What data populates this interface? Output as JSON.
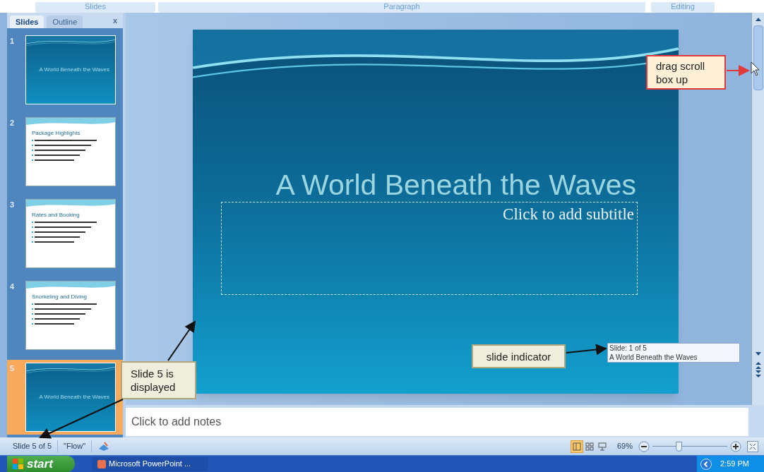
{
  "ribbon_groups": [
    "Slides",
    "Paragraph",
    "Editing"
  ],
  "pane": {
    "tabs": [
      {
        "label": "Slides",
        "selected": true
      },
      {
        "label": "Outline",
        "selected": false
      }
    ],
    "close": "x"
  },
  "thumbnails": [
    {
      "number": "1",
      "kind": "title",
      "title": "A World Beneath the Waves",
      "selected": false
    },
    {
      "number": "2",
      "kind": "bullets",
      "title": "Package Highlights",
      "selected": false
    },
    {
      "number": "3",
      "kind": "bullets",
      "title": "Rates and Booking",
      "selected": false
    },
    {
      "number": "4",
      "kind": "bullets",
      "title": "Snorkeling and Diving",
      "selected": false
    },
    {
      "number": "5",
      "kind": "title",
      "title": "A World Beneath the Waves",
      "selected": true
    }
  ],
  "slide": {
    "title": "A World Beneath the Waves",
    "subtitle_placeholder": "Click to add subtitle"
  },
  "notes": {
    "placeholder": "Click to add notes"
  },
  "scroll_tip": {
    "line_1": "Slide: 1 of 5",
    "line_2": "A World Beneath the Waves"
  },
  "status_bar": {
    "slide": "Slide 5 of 5",
    "theme": "\"Flow\"",
    "zoom": "69%",
    "zoom_slider": {
      "level": 0.35
    },
    "views": [
      {
        "kind": "normal",
        "selected": true
      },
      {
        "kind": "sorter",
        "selected": false
      },
      {
        "kind": "show",
        "selected": false
      }
    ]
  },
  "taskbar": {
    "start": "start",
    "program": "Microsoft PowerPoint ...",
    "time": "2:59 PM"
  },
  "callouts": [
    {
      "kind": "red",
      "text": "drag scroll box up"
    },
    {
      "kind": "plain",
      "text": "slide indicator"
    },
    {
      "kind": "plain",
      "text": "Slide 5 is displayed"
    }
  ]
}
